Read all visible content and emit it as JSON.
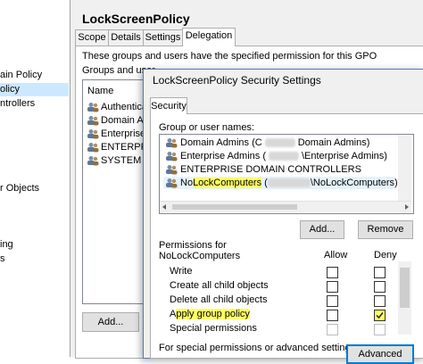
{
  "left_tree": {
    "items": [
      "ain Policy",
      "olicy",
      "ntrollers",
      "r Objects",
      "ing",
      "s"
    ],
    "selected_index": 1
  },
  "main": {
    "title": "LockScreenPolicy",
    "tabs": [
      "Scope",
      "Details",
      "Settings",
      "Delegation"
    ],
    "active_tab": "Delegation",
    "description": "These groups and users have the specified permission for this GPO",
    "groups_label": "Groups and user",
    "list_header": "Name",
    "list_items": [
      "Authenticat",
      "Domain Adm",
      "Enterprise A",
      "ENTERPRISE",
      "SYSTEM"
    ],
    "add_button": "Add..."
  },
  "dialog": {
    "title": "LockScreenPolicy Security Settings",
    "tab": "Security",
    "names_label": "Group or user names:",
    "names": [
      {
        "prefix": "Domain Admins (C",
        "suffix": "Domain Admins)"
      },
      {
        "prefix": "Enterprise Admins (",
        "suffix": "\\Enterprise Admins)"
      },
      {
        "prefix": "ENTERPRISE DOMAIN CONTROLLERS",
        "suffix": ""
      },
      {
        "prefix_plain": "No",
        "prefix_hl": "LockComputers",
        "mid": " (",
        "suffix": "\\NoLockComputers)"
      }
    ],
    "add_button": "Add...",
    "remove_button": "Remove",
    "permissions_label_line1": "Permissions for",
    "permissions_label_line2": "NoLockComputers",
    "allow_header": "Allow",
    "deny_header": "Deny",
    "permissions": [
      {
        "name": "Write",
        "allow": false,
        "deny": false
      },
      {
        "name": "Create all child objects",
        "allow": false,
        "deny": false
      },
      {
        "name": "Delete all child objects",
        "allow": false,
        "deny": false
      },
      {
        "name_plain": "A",
        "name_hl": "pply group policy",
        "allow": false,
        "deny": true
      },
      {
        "name": "Special permissions",
        "allow": false,
        "deny": false
      }
    ],
    "special_text": "For special permissions or advanced settings,",
    "advanced_button": "Advanced"
  },
  "colors": {
    "highlight": "#ffff66",
    "selection": "#cce8ff",
    "dialog_border": "#4a7ebb"
  }
}
